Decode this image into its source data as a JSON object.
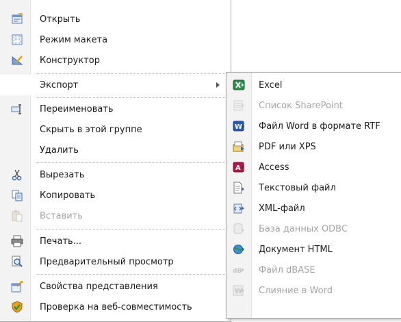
{
  "main_menu": {
    "items": [
      {
        "label": "Открыть",
        "icon": "open-form-icon",
        "disabled": false
      },
      {
        "label": "Режим макета",
        "icon": "layout-view-icon",
        "disabled": false
      },
      {
        "label": "Конструктор",
        "icon": "design-view-icon",
        "disabled": false
      },
      {
        "label": "Экспорт",
        "icon": "",
        "disabled": false,
        "submenu": true
      },
      {
        "label": "Переименовать",
        "icon": "rename-icon",
        "disabled": false
      },
      {
        "label": "Скрыть в этой группе",
        "icon": "",
        "disabled": false
      },
      {
        "label": "Удалить",
        "icon": "",
        "disabled": false
      },
      {
        "label": "Вырезать",
        "icon": "scissors-icon",
        "disabled": false
      },
      {
        "label": "Копировать",
        "icon": "copy-icon",
        "disabled": false
      },
      {
        "label": "Вставить",
        "icon": "paste-icon",
        "disabled": true
      },
      {
        "label": "Печать...",
        "icon": "printer-icon",
        "disabled": false
      },
      {
        "label": "Предварительный просмотр",
        "icon": "print-preview-icon",
        "disabled": false
      },
      {
        "label": "Свойства представления",
        "icon": "view-properties-icon",
        "disabled": false
      },
      {
        "label": "Проверка на веб-совместимость",
        "icon": "web-compat-check-icon",
        "disabled": false
      }
    ]
  },
  "export_submenu": {
    "items": [
      {
        "label": "Excel",
        "icon": "excel-icon",
        "disabled": false
      },
      {
        "label": "Список SharePoint",
        "icon": "sharepoint-list-icon",
        "disabled": true
      },
      {
        "label": "Файл Word в формате RTF",
        "icon": "word-rtf-icon",
        "disabled": false
      },
      {
        "label": "PDF или XPS",
        "icon": "pdf-xps-icon",
        "disabled": false
      },
      {
        "label": "Access",
        "icon": "access-icon",
        "disabled": false
      },
      {
        "label": "Текстовый файл",
        "icon": "text-file-icon",
        "disabled": false
      },
      {
        "label": "XML-файл",
        "icon": "xml-file-icon",
        "disabled": false
      },
      {
        "label": "База данных ODBC",
        "icon": "odbc-database-icon",
        "disabled": true
      },
      {
        "label": "Документ HTML",
        "icon": "html-document-icon",
        "disabled": false
      },
      {
        "label": "Файл dBASE",
        "icon": "dbase-file-icon",
        "disabled": true
      },
      {
        "label": "Слияние в Word",
        "icon": "word-merge-icon",
        "disabled": true
      }
    ]
  },
  "colors": {
    "excel": "#1f7a3a",
    "word": "#2b5cb8",
    "access": "#b0174a",
    "border": "#a8a8a8",
    "disabled_text": "#a4a4a4"
  }
}
